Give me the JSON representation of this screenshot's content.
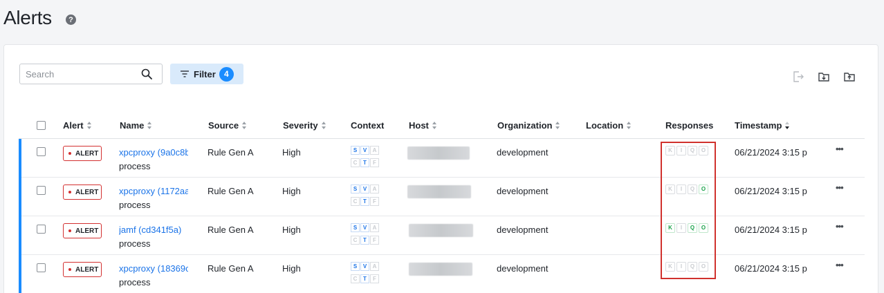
{
  "page": {
    "title": "Alerts",
    "help_icon": "?"
  },
  "toolbar": {
    "search_placeholder": "Search",
    "filter_label": "Filter",
    "filter_count": "4",
    "icons": [
      "export-icon",
      "download-icon",
      "upload-icon"
    ]
  },
  "table": {
    "headers": {
      "alert": "Alert",
      "name": "Name",
      "source": "Source",
      "severity": "Severity",
      "context": "Context",
      "host": "Host",
      "organization": "Organization",
      "location": "Location",
      "responses": "Responses",
      "timestamp": "Timestamp"
    },
    "rows": [
      {
        "badge": "ALERT",
        "name_link": "xpcproxy (9a0c8b",
        "name_sub": "process",
        "source": "Rule Gen A",
        "severity": "High",
        "context": [
          [
            "S",
            "on"
          ],
          [
            "V",
            "on"
          ],
          [
            "A",
            "off"
          ],
          [
            "C",
            "off"
          ],
          [
            "T",
            "on"
          ],
          [
            "F",
            "off"
          ]
        ],
        "organization": "development",
        "responses": [
          [
            "K",
            "off"
          ],
          [
            "I",
            "off"
          ],
          [
            "Q",
            "off"
          ],
          [
            "O",
            "off"
          ]
        ],
        "timestamp": "06/21/2024 3:15 p",
        "more": "•••"
      },
      {
        "badge": "ALERT",
        "name_link": "xpcproxy (1172aa",
        "name_sub": "process",
        "source": "Rule Gen A",
        "severity": "High",
        "context": [
          [
            "S",
            "on"
          ],
          [
            "V",
            "on"
          ],
          [
            "A",
            "off"
          ],
          [
            "C",
            "off"
          ],
          [
            "T",
            "on"
          ],
          [
            "F",
            "off"
          ]
        ],
        "organization": "development",
        "responses": [
          [
            "K",
            "off"
          ],
          [
            "I",
            "off"
          ],
          [
            "Q",
            "off"
          ],
          [
            "O",
            "on"
          ]
        ],
        "timestamp": "06/21/2024 3:15 p",
        "more": "•••"
      },
      {
        "badge": "ALERT",
        "name_link": "jamf (cd341f5a)",
        "name_sub": "process",
        "source": "Rule Gen A",
        "severity": "High",
        "context": [
          [
            "S",
            "on"
          ],
          [
            "V",
            "on"
          ],
          [
            "A",
            "off"
          ],
          [
            "C",
            "off"
          ],
          [
            "T",
            "on"
          ],
          [
            "F",
            "off"
          ]
        ],
        "organization": "development",
        "responses": [
          [
            "K",
            "on"
          ],
          [
            "I",
            "off"
          ],
          [
            "Q",
            "on"
          ],
          [
            "O",
            "on"
          ]
        ],
        "timestamp": "06/21/2024 3:15 p",
        "more": "•••"
      },
      {
        "badge": "ALERT",
        "name_link": "xpcproxy (18369c",
        "name_sub": "process",
        "source": "Rule Gen A",
        "severity": "High",
        "context": [
          [
            "S",
            "on"
          ],
          [
            "V",
            "on"
          ],
          [
            "A",
            "off"
          ],
          [
            "C",
            "off"
          ],
          [
            "T",
            "on"
          ],
          [
            "F",
            "off"
          ]
        ],
        "organization": "development",
        "responses": [
          [
            "K",
            "off"
          ],
          [
            "I",
            "off"
          ],
          [
            "Q",
            "off"
          ],
          [
            "O",
            "off"
          ]
        ],
        "timestamp": "06/21/2024 3:15 p",
        "more": "•••"
      }
    ]
  },
  "colors": {
    "accent": "#1a8cff",
    "alert_red": "#d32f2f",
    "response_on": "#1aa34a",
    "link": "#1a73e8"
  }
}
